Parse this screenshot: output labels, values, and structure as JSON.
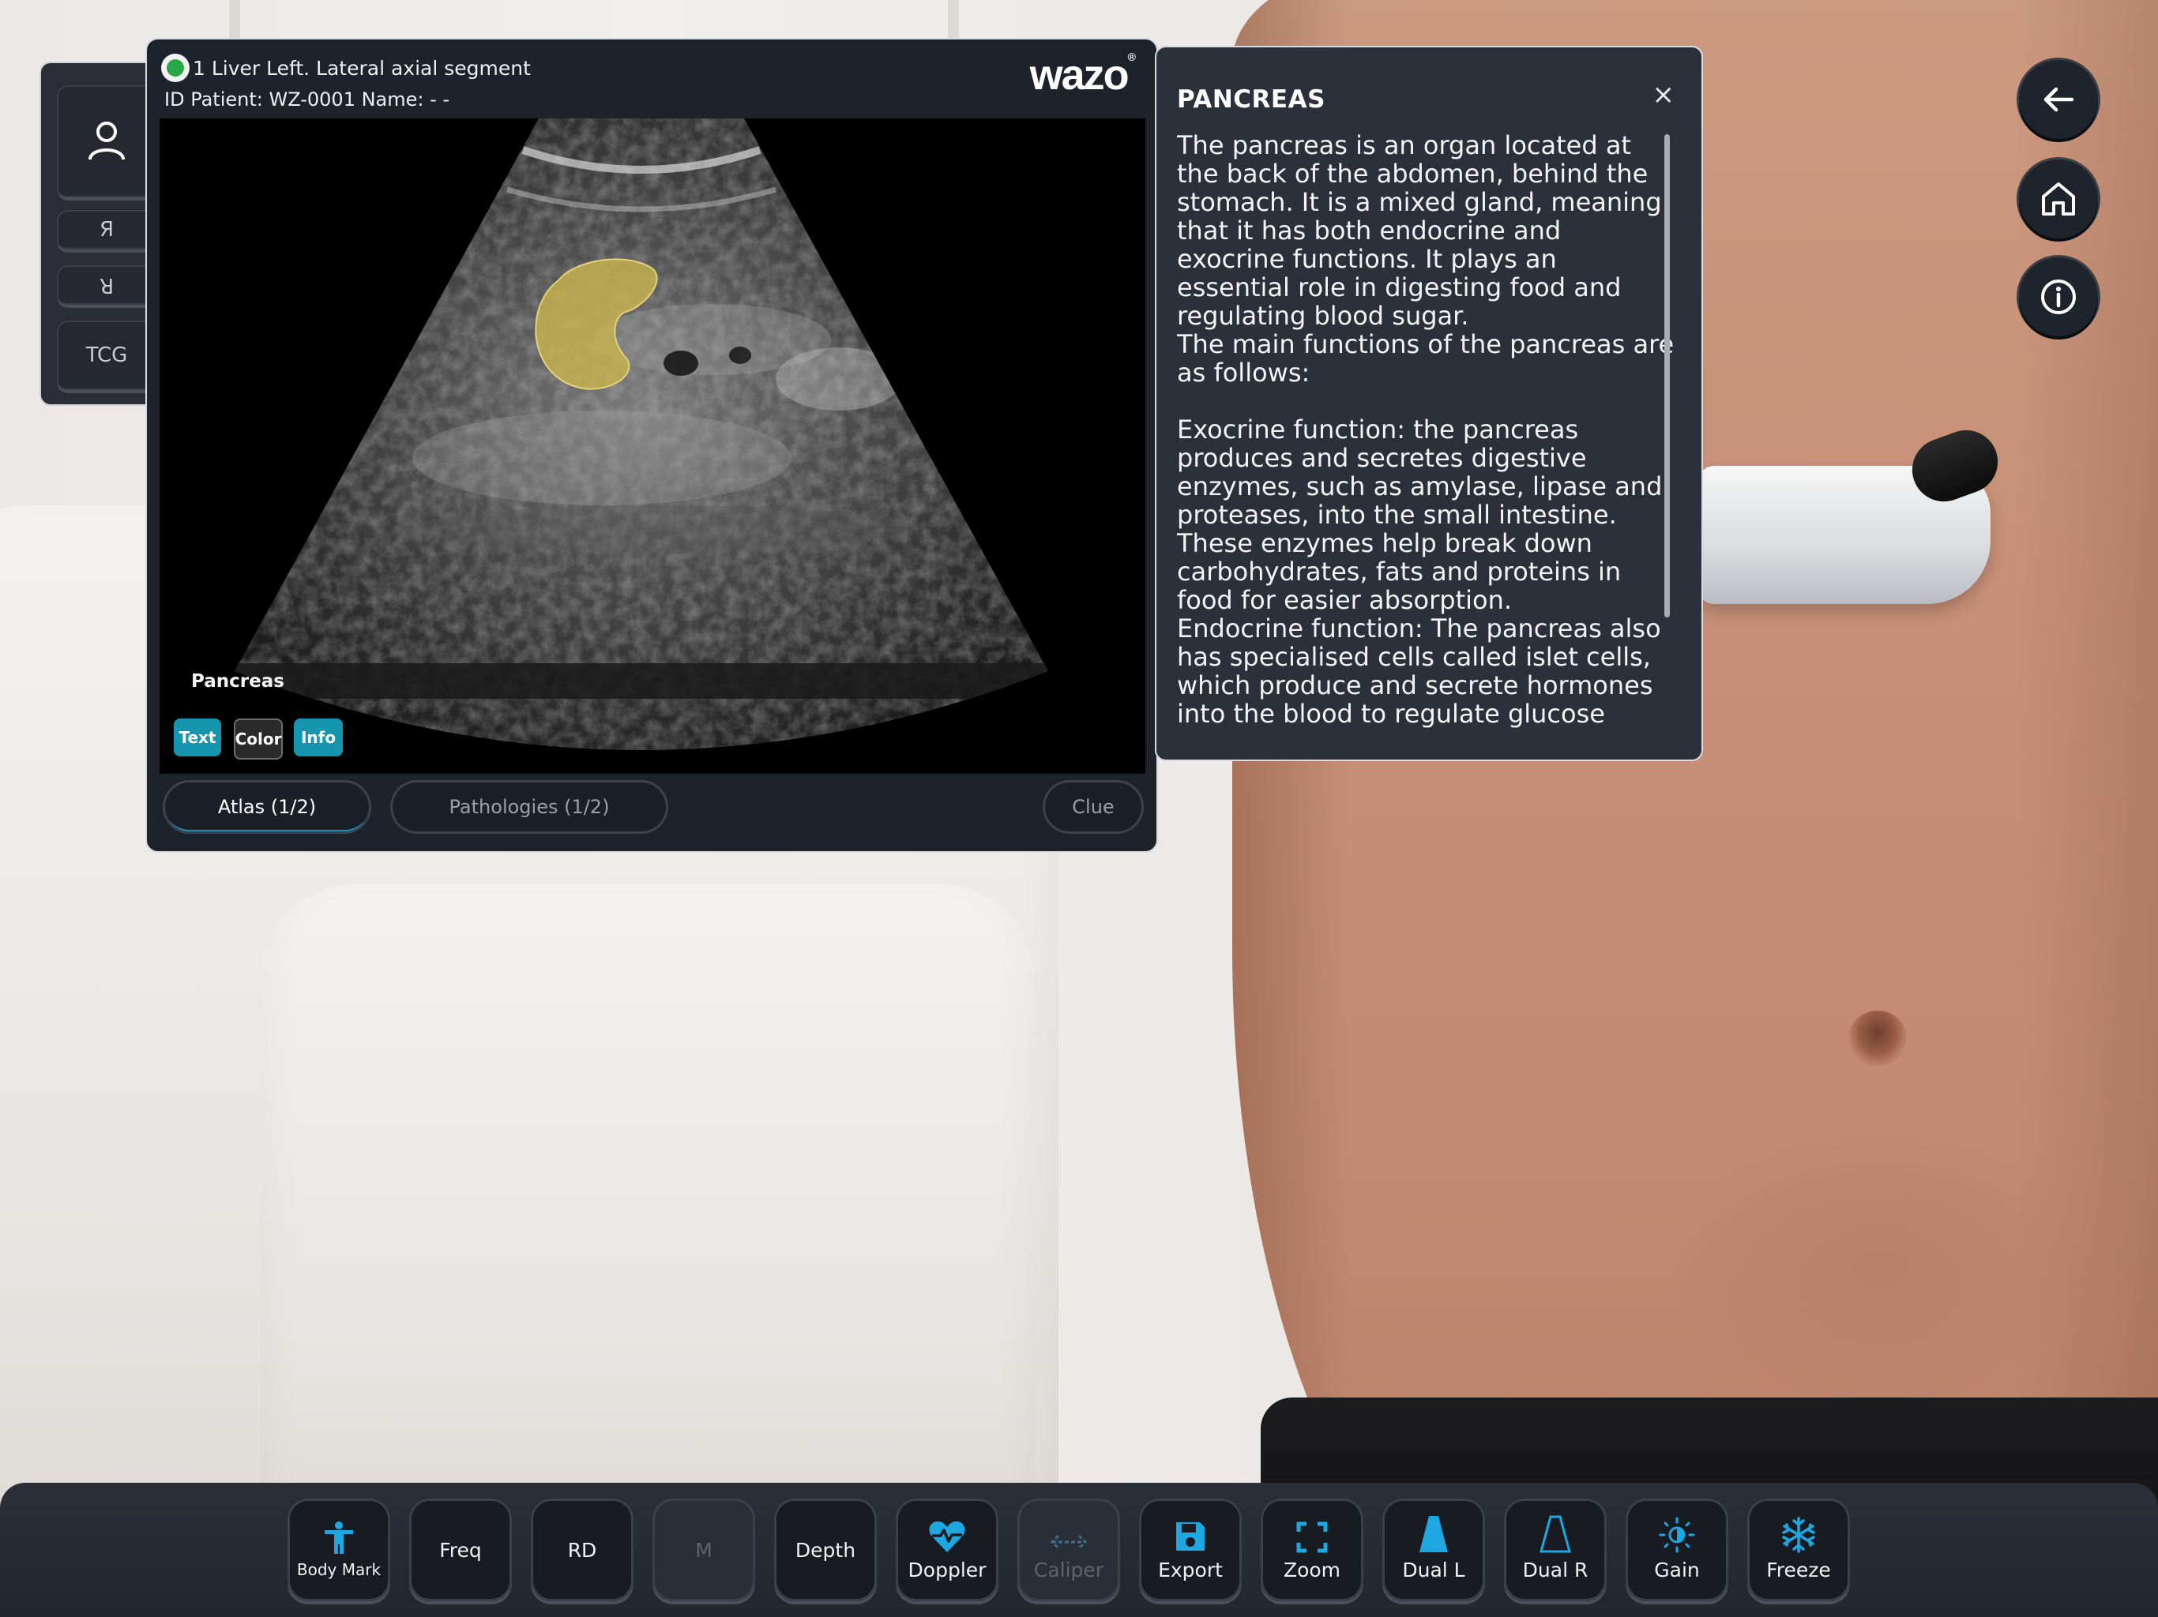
{
  "window": {
    "title": "1 Liver Left. Lateral axial segment",
    "patient_line": "ID Patient: WZ-0001  Name: - -",
    "logo": "wazo",
    "logo_mark": "®",
    "status_color": "#29a845"
  },
  "side_panel": {
    "icon": "user-icon",
    "buttons": [
      "Я",
      "R",
      "TCG"
    ]
  },
  "ultrasound": {
    "organ_label": "Pancreas",
    "highlight_color": "#c9b44d",
    "overlay_buttons": [
      {
        "label": "Text",
        "active": true
      },
      {
        "label": "Color",
        "active": false
      },
      {
        "label": "Info",
        "active": true
      }
    ]
  },
  "tabs": {
    "atlas": "Atlas (1/2)",
    "pathologies": "Pathologies (1/2)",
    "clue": "Clue"
  },
  "info_panel": {
    "title": "PANCREAS",
    "close": "×",
    "body": "The pancreas is an organ located at the back of the abdomen, behind the stomach. It is a mixed gland, meaning that it has both endocrine and exocrine functions. It plays an essential role in digesting food and regulating blood sugar.\nThe main functions of the pancreas are as follows:\n\nExocrine function: the pancreas produces and secretes digestive enzymes, such as amylase, lipase and proteases, into the small intestine. These enzymes help break down carbohydrates, fats and proteins in food for easier absorption.\nEndocrine function: The pancreas also has specialised cells called islet cells, which produce and secrete hormones into the blood to regulate glucose"
  },
  "nav_buttons": [
    "back-arrow-icon",
    "home-icon",
    "info-icon"
  ],
  "toolbar": {
    "items": [
      {
        "label": "Body Mark",
        "icon": "body-mark-icon",
        "enabled": true
      },
      {
        "label": "Freq",
        "icon": "",
        "enabled": true
      },
      {
        "label": "RD",
        "icon": "",
        "enabled": true
      },
      {
        "label": "M",
        "icon": "",
        "enabled": false
      },
      {
        "label": "Depth",
        "icon": "",
        "enabled": true
      },
      {
        "label": "Doppler",
        "icon": "heart-pulse-icon",
        "enabled": true
      },
      {
        "label": "Caliper",
        "icon": "caliper-icon",
        "enabled": false
      },
      {
        "label": "Export",
        "icon": "save-icon",
        "enabled": true
      },
      {
        "label": "Zoom",
        "icon": "zoom-frame-icon",
        "enabled": true
      },
      {
        "label": "Dual L",
        "icon": "dual-left-icon",
        "enabled": true
      },
      {
        "label": "Dual R",
        "icon": "dual-right-icon",
        "enabled": true
      },
      {
        "label": "Gain",
        "icon": "brightness-icon",
        "enabled": true
      },
      {
        "label": "Freeze",
        "icon": "snowflake-icon",
        "enabled": true
      }
    ],
    "accent_color": "#1ea7e0"
  }
}
